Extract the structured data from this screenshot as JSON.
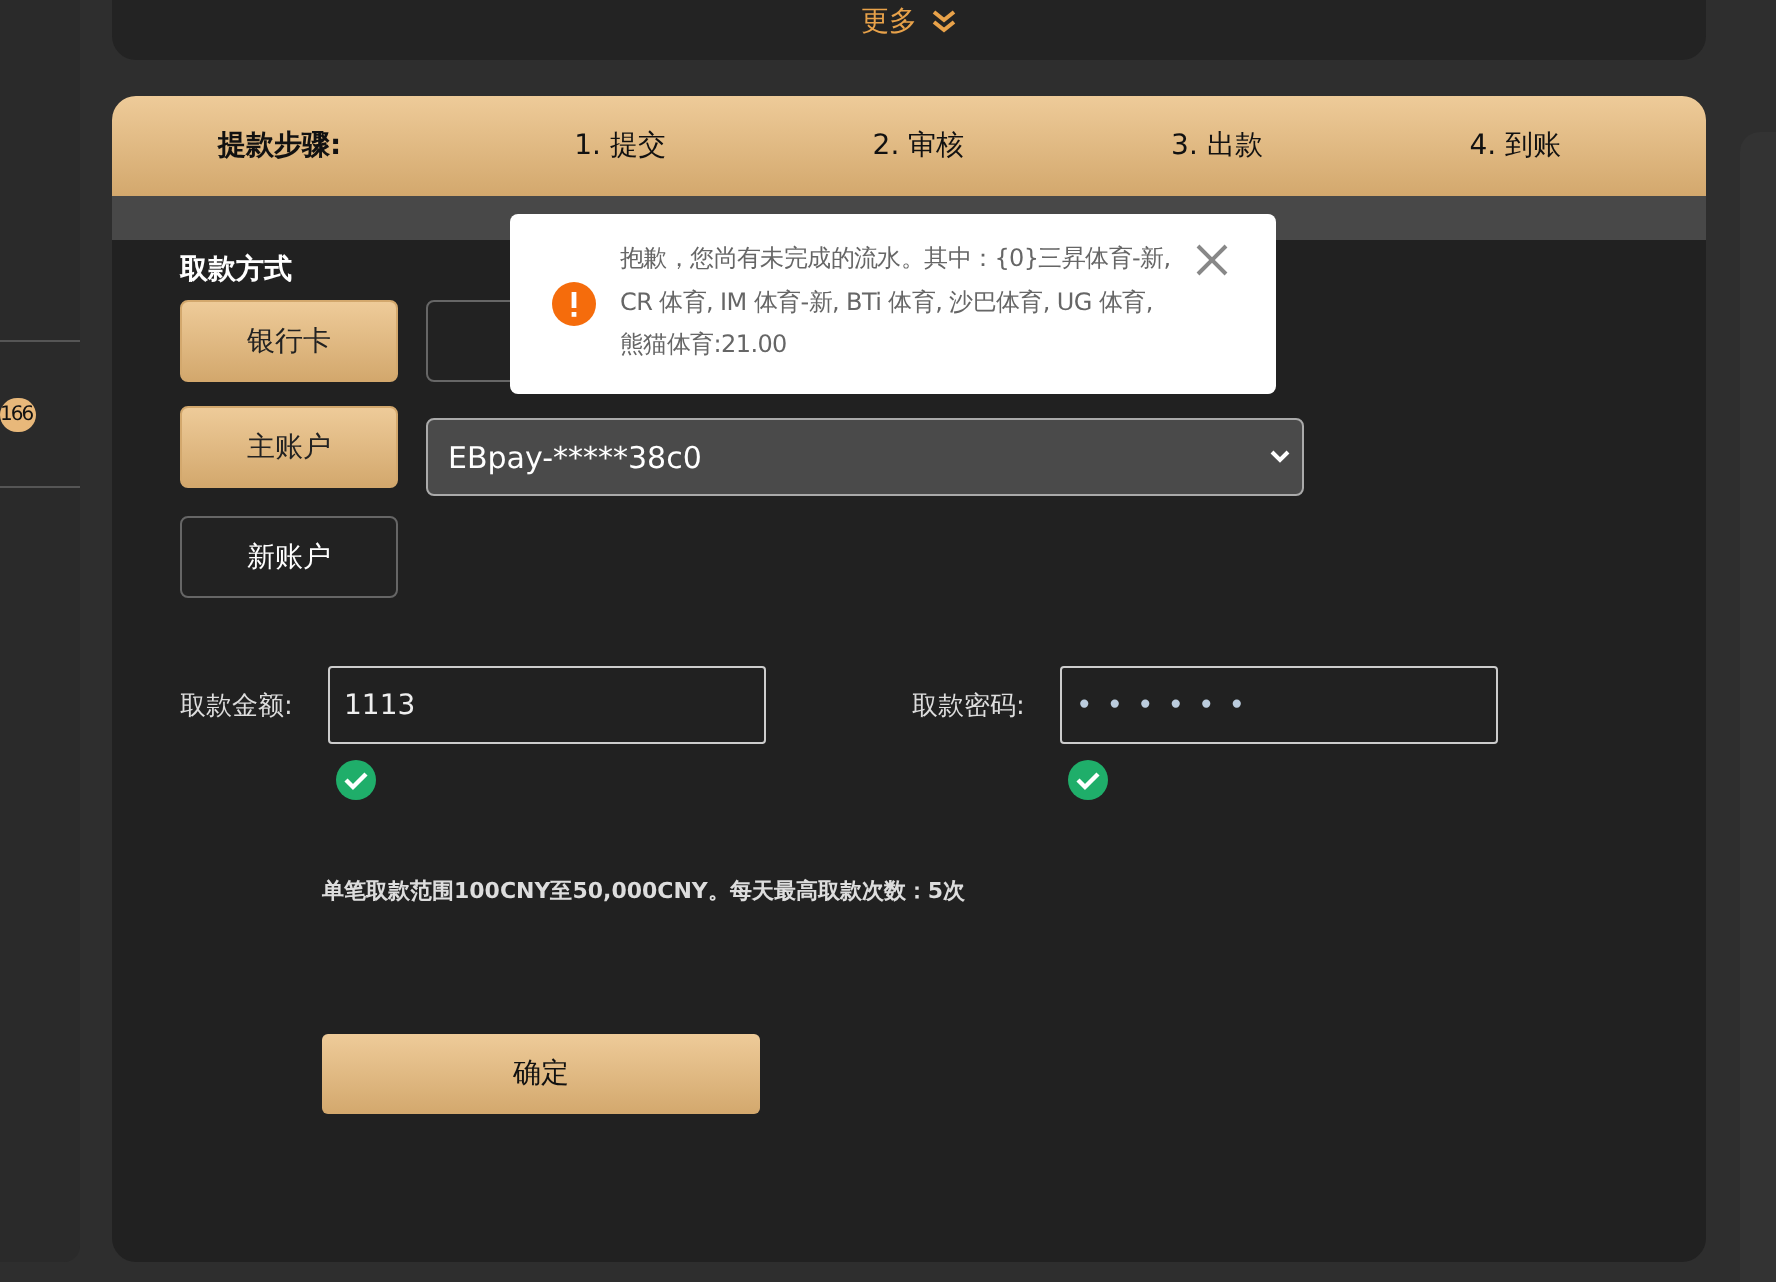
{
  "sidebar": {
    "badge": "166"
  },
  "top_panel": {
    "more_link": "更多"
  },
  "steps": {
    "title": "提款步骤:",
    "items": [
      "1. 提交",
      "2. 审核",
      "3. 出款",
      "4. 到账"
    ]
  },
  "method": {
    "title": "取款方式",
    "buttons": [
      {
        "label": "银行卡",
        "selected": true
      }
    ],
    "accounts": [
      {
        "label": "主账户",
        "selected": true
      },
      {
        "label": "新账户",
        "selected": false
      }
    ],
    "account_select": {
      "value": "EBpay-*****38c0"
    }
  },
  "amount": {
    "label": "取款金额:",
    "value": "1113",
    "valid": true
  },
  "password": {
    "label": "取款密码:",
    "value": "••••••",
    "valid": true
  },
  "note": "单笔取款范围100CNY至50,000CNY。每天最高取款次数：5次",
  "confirm": "确定",
  "toast": {
    "message": "抱歉，您尚有未完成的流水。其中：{0}三昇体育-新, CR 体育, IM 体育-新, BTi 体育, 沙巴体育, UG 体育, 熊猫体育:21.00"
  }
}
